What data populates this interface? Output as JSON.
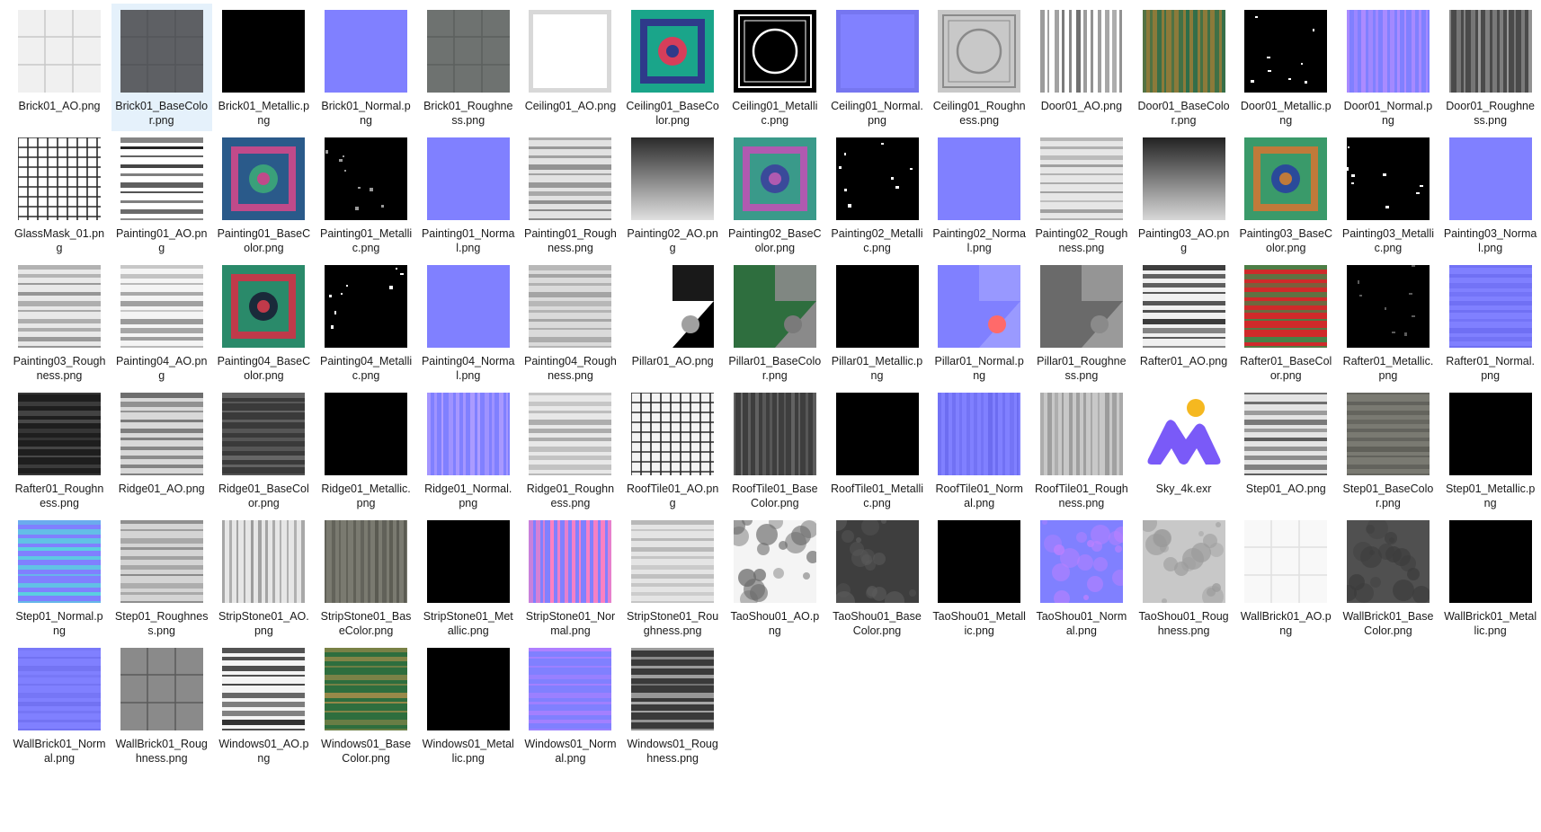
{
  "selected_index": 1,
  "files": [
    {
      "name": "Brick01_AO.png",
      "kind": "tile-grid",
      "colors": [
        "#f0f0f0",
        "#c8c8c8"
      ]
    },
    {
      "name": "Brick01_BaseColor.png",
      "kind": "tile-grid",
      "colors": [
        "#5e6064",
        "#54565a"
      ]
    },
    {
      "name": "Brick01_Metallic.png",
      "kind": "solid",
      "colors": [
        "#000000"
      ]
    },
    {
      "name": "Brick01_Normal.png",
      "kind": "solid",
      "colors": [
        "#8080ff"
      ]
    },
    {
      "name": "Brick01_Roughness.png",
      "kind": "tile-grid",
      "colors": [
        "#6e7270",
        "#5c605e"
      ]
    },
    {
      "name": "Ceiling01_AO.png",
      "kind": "frame",
      "colors": [
        "#ffffff",
        "#d8d8d8"
      ]
    },
    {
      "name": "Ceiling01_BaseColor.png",
      "kind": "ornament",
      "colors": [
        "#1aa58a",
        "#d63e5a",
        "#2e3a8a"
      ]
    },
    {
      "name": "Ceiling01_Metallic.png",
      "kind": "circle-frame",
      "colors": [
        "#000000",
        "#ffffff"
      ]
    },
    {
      "name": "Ceiling01_Normal.png",
      "kind": "frame",
      "colors": [
        "#8181ff",
        "#7676f0"
      ]
    },
    {
      "name": "Ceiling01_Roughness.png",
      "kind": "circle-frame",
      "colors": [
        "#c8c8c8",
        "#8a8a8a"
      ]
    },
    {
      "name": "Door01_AO.png",
      "kind": "stripes-v",
      "colors": [
        "#ffffff",
        "#6e6e6e"
      ]
    },
    {
      "name": "Door01_BaseColor.png",
      "kind": "stripes-v",
      "colors": [
        "#8c7a3a",
        "#2e6e4a"
      ]
    },
    {
      "name": "Door01_Metallic.png",
      "kind": "dots",
      "colors": [
        "#000000",
        "#ffffff"
      ]
    },
    {
      "name": "Door01_Normal.png",
      "kind": "stripes-v",
      "colors": [
        "#8080ff",
        "#b08cff"
      ]
    },
    {
      "name": "Door01_Roughness.png",
      "kind": "stripes-v",
      "colors": [
        "#4a4a4a",
        "#9a9a9a"
      ]
    },
    {
      "name": "GlassMask_01.png",
      "kind": "lattice",
      "colors": [
        "#ffffff",
        "#2a2a2a"
      ]
    },
    {
      "name": "Painting01_AO.png",
      "kind": "stripes-h",
      "colors": [
        "#ffffff",
        "#1a1a1a"
      ]
    },
    {
      "name": "Painting01_BaseColor.png",
      "kind": "ornament",
      "colors": [
        "#2a5a8a",
        "#3aa07a",
        "#c04a8a"
      ]
    },
    {
      "name": "Painting01_Metallic.png",
      "kind": "dots",
      "colors": [
        "#000000",
        "#9a9a9a"
      ]
    },
    {
      "name": "Painting01_Normal.png",
      "kind": "solid",
      "colors": [
        "#8080ff"
      ]
    },
    {
      "name": "Painting01_Roughness.png",
      "kind": "stripes-h",
      "colors": [
        "#e2e2e2",
        "#8a8a8a"
      ]
    },
    {
      "name": "Painting02_AO.png",
      "kind": "gradient",
      "colors": [
        "#2a2a2a",
        "#e0e0e0"
      ]
    },
    {
      "name": "Painting02_BaseColor.png",
      "kind": "ornament",
      "colors": [
        "#3a9a8a",
        "#3a4a9a",
        "#b05ab0"
      ]
    },
    {
      "name": "Painting02_Metallic.png",
      "kind": "dots",
      "colors": [
        "#000000",
        "#ffffff"
      ]
    },
    {
      "name": "Painting02_Normal.png",
      "kind": "solid",
      "colors": [
        "#8080ff"
      ]
    },
    {
      "name": "Painting02_Roughness.png",
      "kind": "stripes-h",
      "colors": [
        "#e6e6e6",
        "#9a9a9a"
      ]
    },
    {
      "name": "Painting03_AO.png",
      "kind": "gradient",
      "colors": [
        "#222222",
        "#d8d8d8"
      ]
    },
    {
      "name": "Painting03_BaseColor.png",
      "kind": "ornament",
      "colors": [
        "#3a9a6a",
        "#2a4a9a",
        "#c07a3a"
      ]
    },
    {
      "name": "Painting03_Metallic.png",
      "kind": "dots",
      "colors": [
        "#000000",
        "#ffffff"
      ]
    },
    {
      "name": "Painting03_Normal.png",
      "kind": "solid",
      "colors": [
        "#8080ff"
      ]
    },
    {
      "name": "Painting03_Roughness.png",
      "kind": "stripes-h",
      "colors": [
        "#e8e8e8",
        "#8e8e8e"
      ]
    },
    {
      "name": "Painting04_AO.png",
      "kind": "stripes-h",
      "colors": [
        "#f4f4f4",
        "#9a9a9a"
      ]
    },
    {
      "name": "Painting04_BaseColor.png",
      "kind": "ornament",
      "colors": [
        "#2a8a6a",
        "#1a2a3a",
        "#c03a4a"
      ]
    },
    {
      "name": "Painting04_Metallic.png",
      "kind": "dots",
      "colors": [
        "#000000",
        "#ffffff"
      ]
    },
    {
      "name": "Painting04_Normal.png",
      "kind": "solid",
      "colors": [
        "#8080ff"
      ]
    },
    {
      "name": "Painting04_Roughness.png",
      "kind": "stripes-h",
      "colors": [
        "#dadada",
        "#a0a0a0"
      ]
    },
    {
      "name": "Pillar01_AO.png",
      "kind": "split-diag",
      "colors": [
        "#ffffff",
        "#000000",
        "#a0a0a0"
      ]
    },
    {
      "name": "Pillar01_BaseColor.png",
      "kind": "split-diag",
      "colors": [
        "#2e6e3e",
        "#8a8a8a",
        "#7a7a7a"
      ]
    },
    {
      "name": "Pillar01_Metallic.png",
      "kind": "solid",
      "colors": [
        "#000000"
      ]
    },
    {
      "name": "Pillar01_Normal.png",
      "kind": "split-diag",
      "colors": [
        "#8080ff",
        "#9a9aff",
        "#ff6a6a"
      ]
    },
    {
      "name": "Pillar01_Roughness.png",
      "kind": "split-diag",
      "colors": [
        "#6a6a6a",
        "#9a9a9a",
        "#8a8a8a"
      ]
    },
    {
      "name": "Rafter01_AO.png",
      "kind": "stripes-h",
      "colors": [
        "#f0f0f0",
        "#3a3a3a"
      ]
    },
    {
      "name": "Rafter01_BaseColor.png",
      "kind": "stripes-h",
      "colors": [
        "#d02a2a",
        "#3a8a4a"
      ]
    },
    {
      "name": "Rafter01_Metallic.png",
      "kind": "dots",
      "colors": [
        "#000000",
        "#5a5a5a"
      ]
    },
    {
      "name": "Rafter01_Normal.png",
      "kind": "stripes-h",
      "colors": [
        "#8080ff",
        "#6a6af0"
      ]
    },
    {
      "name": "Rafter01_Roughness.png",
      "kind": "stripes-h",
      "colors": [
        "#1e1e1e",
        "#4a4a4a"
      ]
    },
    {
      "name": "Ridge01_AO.png",
      "kind": "stripes-h",
      "colors": [
        "#d8d8d8",
        "#6a6a6a"
      ]
    },
    {
      "name": "Ridge01_BaseColor.png",
      "kind": "stripes-h",
      "colors": [
        "#3a3a3a",
        "#6a6a6a"
      ]
    },
    {
      "name": "Ridge01_Metallic.png",
      "kind": "solid",
      "colors": [
        "#000000"
      ]
    },
    {
      "name": "Ridge01_Normal.png",
      "kind": "stripes-v",
      "colors": [
        "#8080ff",
        "#b4a0ff"
      ]
    },
    {
      "name": "Ridge01_Roughness.png",
      "kind": "stripes-h",
      "colors": [
        "#e8e8e8",
        "#aaaaaa"
      ]
    },
    {
      "name": "RoofTile01_AO.png",
      "kind": "lattice",
      "colors": [
        "#f4f4f4",
        "#2a2a2a"
      ]
    },
    {
      "name": "RoofTile01_BaseColor.png",
      "kind": "stripes-v",
      "colors": [
        "#3e3e3e",
        "#6a6a6a"
      ]
    },
    {
      "name": "RoofTile01_Metallic.png",
      "kind": "solid",
      "colors": [
        "#000000"
      ]
    },
    {
      "name": "RoofTile01_Normal.png",
      "kind": "stripes-v",
      "colors": [
        "#8080ff",
        "#6c6cf0"
      ]
    },
    {
      "name": "RoofTile01_Roughness.png",
      "kind": "stripes-v",
      "colors": [
        "#c8c8c8",
        "#9a9a9a"
      ]
    },
    {
      "name": "Sky_4k.exr",
      "kind": "app-logo",
      "colors": [
        "#7a5af8",
        "#f5b820"
      ]
    },
    {
      "name": "Step01_AO.png",
      "kind": "stripes-h",
      "colors": [
        "#e4e4e4",
        "#5a5a5a"
      ]
    },
    {
      "name": "Step01_BaseColor.png",
      "kind": "stripes-h",
      "colors": [
        "#7a7a72",
        "#5e5e58"
      ]
    },
    {
      "name": "Step01_Metallic.png",
      "kind": "solid",
      "colors": [
        "#000000"
      ]
    },
    {
      "name": "Step01_Normal.png",
      "kind": "stripes-h",
      "colors": [
        "#8080ff",
        "#5ad0e0"
      ]
    },
    {
      "name": "Step01_Roughness.png",
      "kind": "stripes-h",
      "colors": [
        "#d4d4d4",
        "#8a8a8a"
      ]
    },
    {
      "name": "StripStone01_AO.png",
      "kind": "stripes-v",
      "colors": [
        "#e6e6e6",
        "#9a9a9a"
      ]
    },
    {
      "name": "StripStone01_BaseColor.png",
      "kind": "stripes-v",
      "colors": [
        "#7a7a70",
        "#5a5a52"
      ]
    },
    {
      "name": "StripStone01_Metallic.png",
      "kind": "solid",
      "colors": [
        "#000000"
      ]
    },
    {
      "name": "StripStone01_Normal.png",
      "kind": "stripes-v",
      "colors": [
        "#8080ff",
        "#ff80c0"
      ]
    },
    {
      "name": "StripStone01_Roughness.png",
      "kind": "stripes-h",
      "colors": [
        "#e4e4e4",
        "#b4b4b4"
      ]
    },
    {
      "name": "TaoShou01_AO.png",
      "kind": "noise",
      "colors": [
        "#f4f4f4",
        "#6a6a6a"
      ]
    },
    {
      "name": "TaoShou01_BaseColor.png",
      "kind": "noise",
      "colors": [
        "#3e3e3e",
        "#5a5a5a"
      ]
    },
    {
      "name": "TaoShou01_Metallic.png",
      "kind": "solid",
      "colors": [
        "#000000"
      ]
    },
    {
      "name": "TaoShou01_Normal.png",
      "kind": "noise",
      "colors": [
        "#8080ff",
        "#c080ff"
      ]
    },
    {
      "name": "TaoShou01_Roughness.png",
      "kind": "noise",
      "colors": [
        "#c8c8c8",
        "#9a9a9a"
      ]
    },
    {
      "name": "WallBrick01_AO.png",
      "kind": "tile-grid",
      "colors": [
        "#f8f8f8",
        "#e0e0e0"
      ]
    },
    {
      "name": "WallBrick01_BaseColor.png",
      "kind": "noise",
      "colors": [
        "#505050",
        "#3c3c3c"
      ]
    },
    {
      "name": "WallBrick01_Metallic.png",
      "kind": "solid",
      "colors": [
        "#000000"
      ]
    },
    {
      "name": "WallBrick01_Normal.png",
      "kind": "stripes-h",
      "colors": [
        "#8080ff",
        "#7070f0"
      ]
    },
    {
      "name": "WallBrick01_Roughness.png",
      "kind": "tile-grid",
      "colors": [
        "#8a8a8a",
        "#5a5a5a"
      ]
    },
    {
      "name": "Windows01_AO.png",
      "kind": "stripes-h",
      "colors": [
        "#f4f4f4",
        "#2a2a2a"
      ]
    },
    {
      "name": "Windows01_BaseColor.png",
      "kind": "stripes-h",
      "colors": [
        "#2e6e3e",
        "#9a8a4a"
      ]
    },
    {
      "name": "Windows01_Metallic.png",
      "kind": "solid",
      "colors": [
        "#000000"
      ]
    },
    {
      "name": "Windows01_Normal.png",
      "kind": "stripes-h",
      "colors": [
        "#8080ff",
        "#b080ff"
      ]
    },
    {
      "name": "Windows01_Roughness.png",
      "kind": "stripes-h",
      "colors": [
        "#3a3a3a",
        "#a8a8a8"
      ]
    }
  ]
}
